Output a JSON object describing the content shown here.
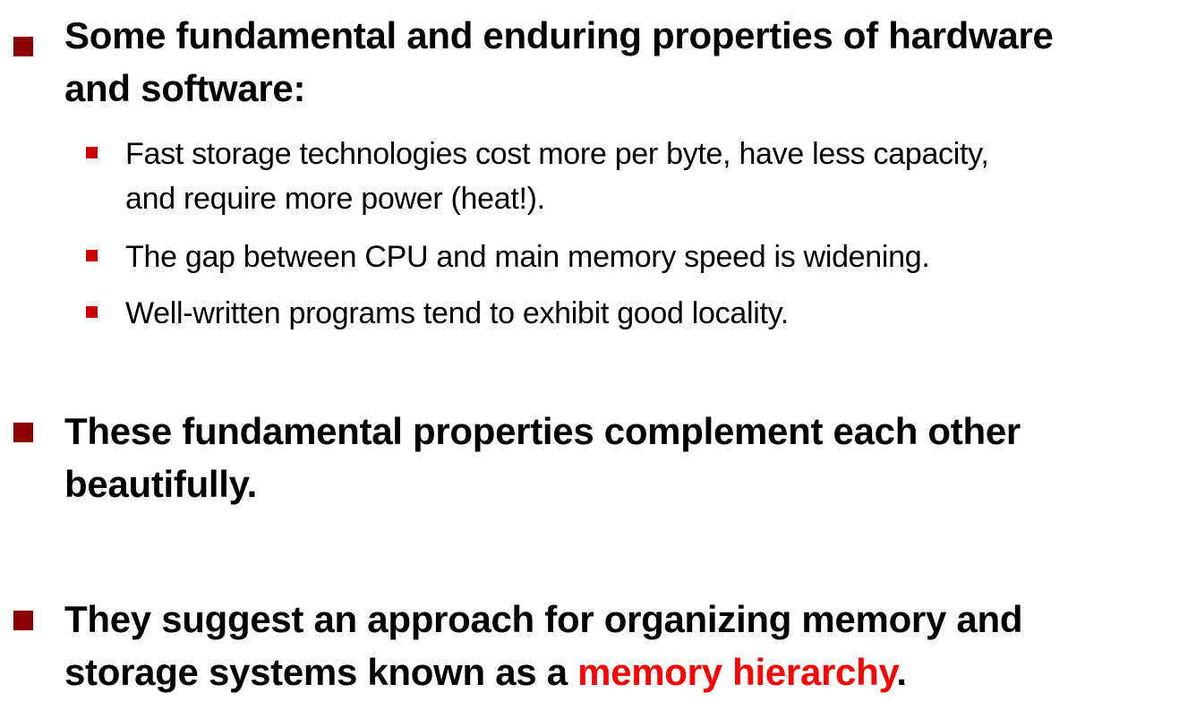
{
  "bullets": [
    {
      "line1": "Some fundamental and enduring properties of hardware",
      "line2": "and software:",
      "sub": [
        {
          "line1": "Fast storage technologies cost more per byte, have less capacity,",
          "line2": "and require more power (heat!)."
        },
        {
          "line1": "The gap between CPU and main memory speed is widening."
        },
        {
          "line1": "Well-written programs tend to exhibit good locality."
        }
      ]
    },
    {
      "line1": "These fundamental properties complement each other",
      "line2": "beautifully."
    },
    {
      "line1": "They suggest an approach for organizing memory and",
      "line2_before": "storage systems known as a ",
      "line2_highlight": "memory hierarchy",
      "line2_after": "."
    }
  ],
  "colors": {
    "bullet_l1": "#8b0000",
    "bullet_l2": "#cc0000",
    "highlight": "#ff0000"
  }
}
